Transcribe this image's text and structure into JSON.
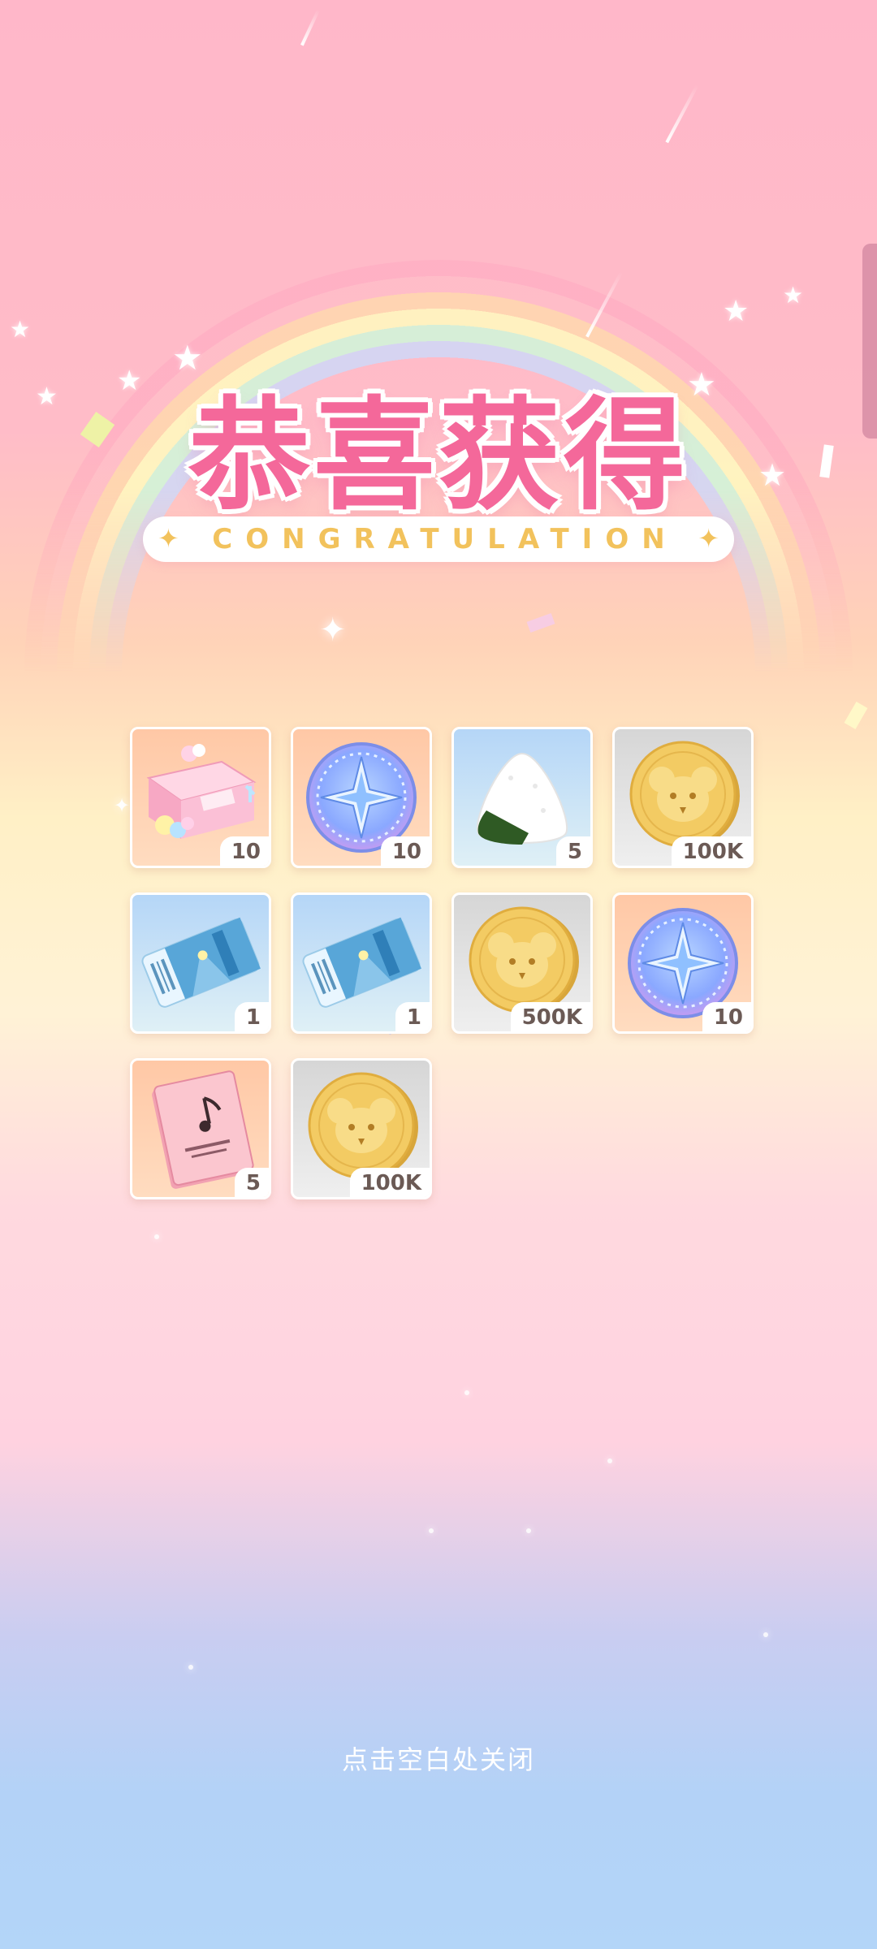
{
  "title": {
    "text": "恭喜获得",
    "subtitle": "CONGRATULATION"
  },
  "rewards": [
    {
      "name": "gift box",
      "icon": "gift-box-icon",
      "quantity": "10",
      "background": "orange"
    },
    {
      "name": "star compass token",
      "icon": "star-compass-coin-icon",
      "quantity": "10",
      "background": "orange"
    },
    {
      "name": "rice ball",
      "icon": "onigiri-icon",
      "quantity": "5",
      "background": "blue"
    },
    {
      "name": "koala gold coin",
      "icon": "koala-coin-icon",
      "quantity": "100K",
      "background": "gray"
    },
    {
      "name": "blue ticket",
      "icon": "ticket-icon",
      "quantity": "1",
      "background": "blue"
    },
    {
      "name": "blue ticket",
      "icon": "ticket-icon",
      "quantity": "1",
      "background": "blue"
    },
    {
      "name": "koala gold coin",
      "icon": "koala-coin-icon",
      "quantity": "500K",
      "background": "gray"
    },
    {
      "name": "star compass token",
      "icon": "star-compass-coin-icon",
      "quantity": "10",
      "background": "orange"
    },
    {
      "name": "music book",
      "icon": "music-book-icon",
      "quantity": "5",
      "background": "orange"
    },
    {
      "name": "koala gold coin",
      "icon": "koala-coin-icon",
      "quantity": "100K",
      "background": "gray"
    }
  ],
  "footer": {
    "close_hint": "点击空白处关闭"
  },
  "colors": {
    "title_pink": "#f4689a",
    "banner_gold": "#f2c25c",
    "qty_text": "#6b5a55"
  }
}
